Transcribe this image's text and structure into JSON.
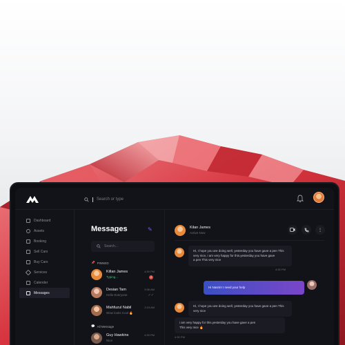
{
  "app": {
    "search_placeholder": "Search or type"
  },
  "sidebar": {
    "items": [
      {
        "label": "Dashboard",
        "icon": "grid-icon",
        "active": false
      },
      {
        "label": "Assets",
        "icon": "user-icon",
        "active": false
      },
      {
        "label": "Booking",
        "icon": "calendar-icon",
        "active": false
      },
      {
        "label": "Sell Cars",
        "icon": "car-icon",
        "active": false
      },
      {
        "label": "Buy Cars",
        "icon": "cart-icon",
        "active": false
      },
      {
        "label": "Services",
        "icon": "tools-icon",
        "active": false
      },
      {
        "label": "Calender",
        "icon": "calendar-icon",
        "active": false
      },
      {
        "label": "Messages",
        "icon": "chat-icon",
        "active": true
      }
    ]
  },
  "messages": {
    "title": "Messages",
    "search_placeholder": "Search...",
    "pinned_label": "PINNED",
    "all_label": "All Message",
    "pinned": [
      {
        "name": "Killan James",
        "preview": "Typing...",
        "time": "4:30 PM",
        "badge": "2"
      },
      {
        "name": "Desian Tam",
        "preview": "Hello Everyone",
        "time": "9:36 AM",
        "read": "✓✓"
      },
      {
        "name": "Mahfuzul Nabil",
        "preview": "Wow looks Cool 🔥",
        "time": "2:15 AM"
      }
    ],
    "all": [
      {
        "name": "Guy Hawkins",
        "preview": "Nice",
        "time": "4:30 PM"
      }
    ]
  },
  "chat": {
    "contact_name": "Kilan James",
    "contact_status": "Active Now",
    "messages": [
      {
        "from": "them",
        "text_1": "Hi, I hope you are doing well, yesterday you have gave a pen This",
        "text_2": "very nice, i am very happy for this.yesterday you have gave",
        "text_3": "a pen This very nice",
        "time": "4:30 PM"
      },
      {
        "from": "me",
        "text_1": "Hi Nasrin! I need your help",
        "text_2": "",
        "text_3": "",
        "time": ""
      },
      {
        "from": "them",
        "text_1": "Hi, I hope you are doing well, yesterday you have gave a pen This",
        "text_2": "very nice",
        "text_3": "",
        "time": ""
      },
      {
        "from": "them",
        "text_1": "i am very happy for this.yesterday you have gave a pen",
        "text_2": "This very nice 🔥",
        "text_3": "",
        "time": "4:30 PM"
      }
    ]
  },
  "colors": {
    "accent": "#7c5cff",
    "app_bg": "#121319",
    "badge": "#e0483b",
    "typing": "#3fbf7f"
  }
}
